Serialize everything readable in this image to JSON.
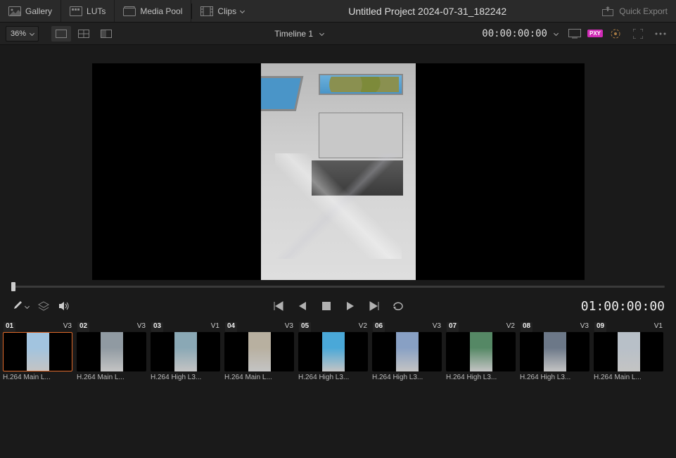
{
  "topbar": {
    "gallery_label": "Gallery",
    "luts_label": "LUTs",
    "media_pool_label": "Media Pool",
    "clips_label": "Clips",
    "quick_export_label": "Quick Export"
  },
  "project_title": "Untitled Project 2024-07-31_182242",
  "secondbar": {
    "zoom_value": "36%",
    "timeline_name": "Timeline 1",
    "source_timecode": "00:00:00:00",
    "proxy_badge": "PXY"
  },
  "viewer_timecode": "01:00:00:00",
  "clips": [
    {
      "index": "01",
      "track": "V3",
      "label": "H.264 Main L...",
      "selected": true
    },
    {
      "index": "02",
      "track": "V3",
      "label": "H.264 Main L...",
      "selected": false
    },
    {
      "index": "03",
      "track": "V1",
      "label": "H.264 High L3...",
      "selected": false
    },
    {
      "index": "04",
      "track": "V3",
      "label": "H.264 Main L...",
      "selected": false
    },
    {
      "index": "05",
      "track": "V2",
      "label": "H.264 High L3...",
      "selected": false
    },
    {
      "index": "06",
      "track": "V3",
      "label": "H.264 High L3...",
      "selected": false
    },
    {
      "index": "07",
      "track": "V2",
      "label": "H.264 High L3...",
      "selected": false
    },
    {
      "index": "08",
      "track": "V3",
      "label": "H.264 High L3...",
      "selected": false
    },
    {
      "index": "09",
      "track": "V1",
      "label": "H.264 Main L...",
      "selected": false
    }
  ]
}
